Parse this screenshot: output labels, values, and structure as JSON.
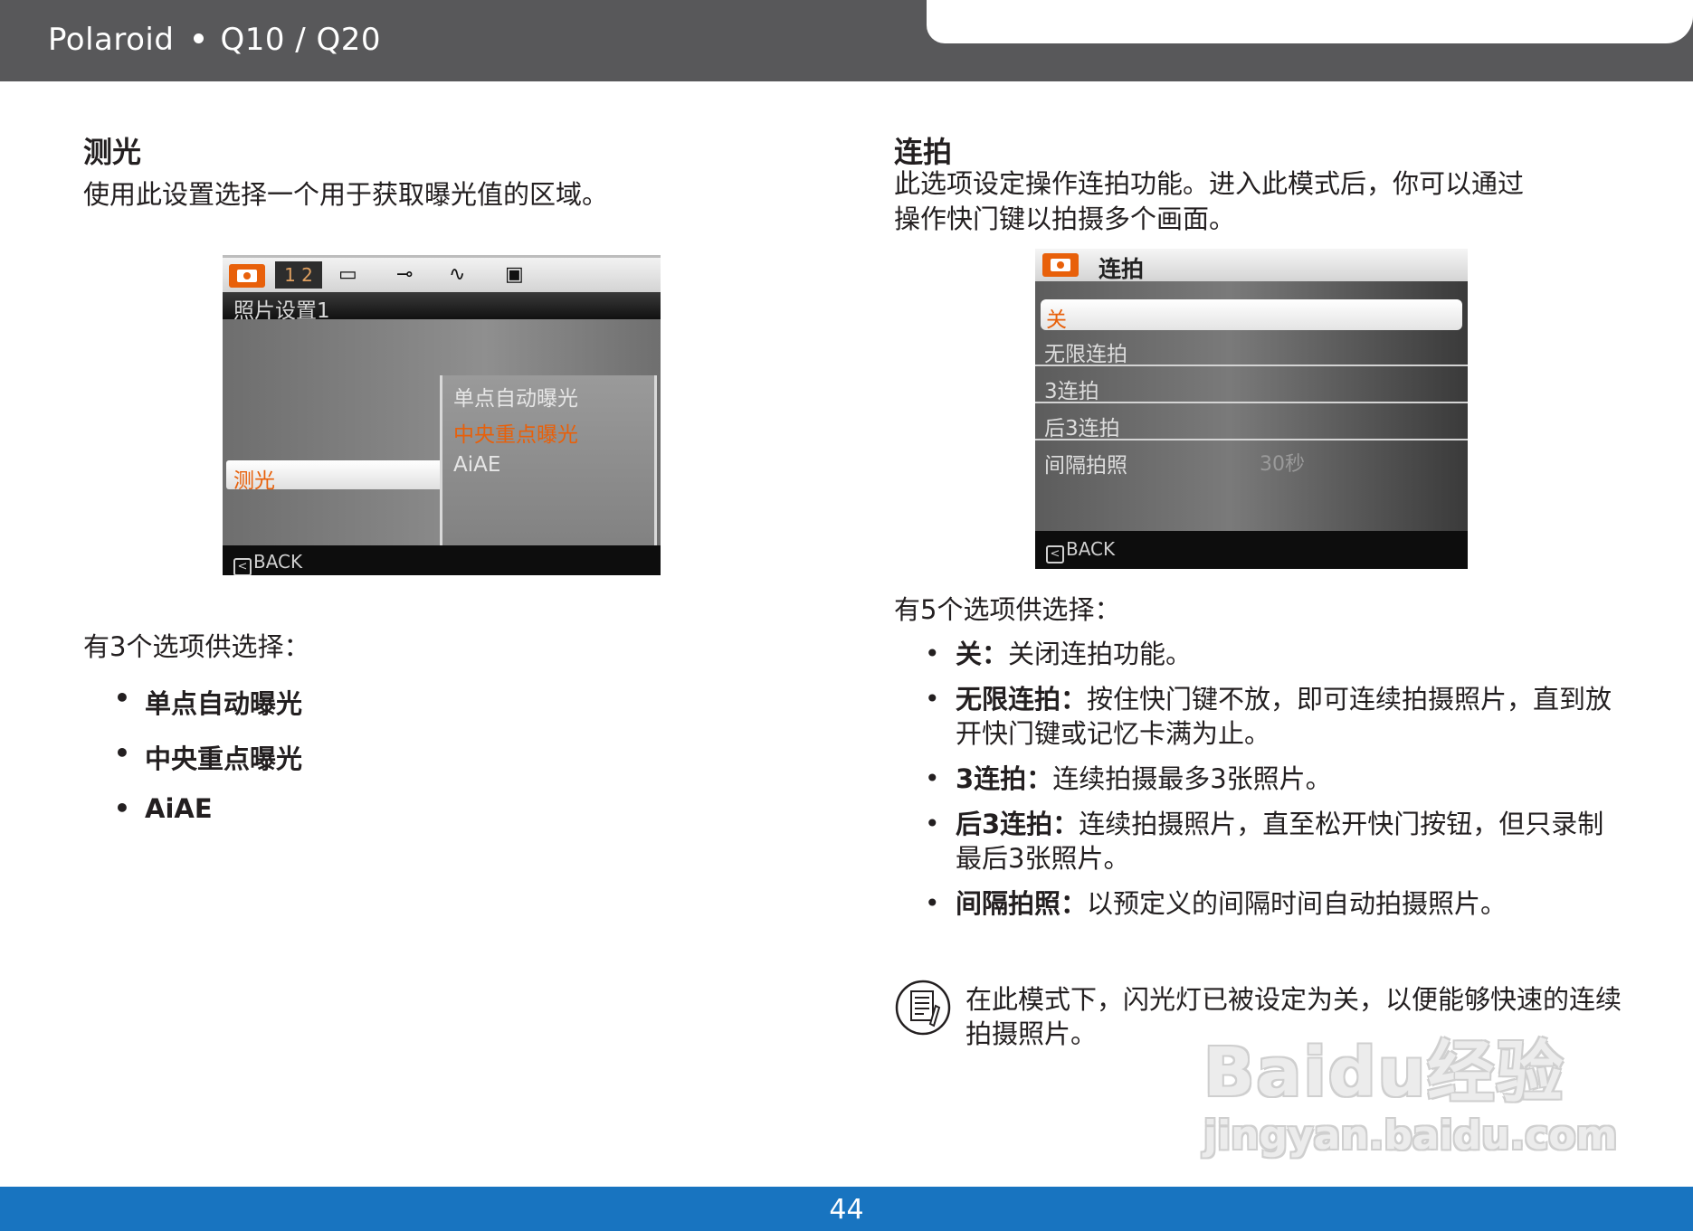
{
  "header": {
    "brand": "Polaroid",
    "model": "Q10 / Q20"
  },
  "left": {
    "title": "测光",
    "desc": "使用此设置选择一个用于获取曝光值的区域。",
    "screen": {
      "tab_numbers": "1 2",
      "title": "照片设置1",
      "selected_label": "测光",
      "options": [
        "单点自动曝光",
        "中央重点曝光",
        "AiAE"
      ],
      "active_option": "中央重点曝光",
      "back": "BACK"
    },
    "count_text": "有3个选项供选择：",
    "bullets": [
      "单点自动曝光",
      "中央重点曝光",
      "AiAE"
    ]
  },
  "right": {
    "title": "连拍",
    "desc_line1": "此选项设定操作连拍功能。进入此模式后，你可以通过",
    "desc_line2": "操作快门键以拍摄多个画面。",
    "screen": {
      "title": "连拍",
      "rows": [
        {
          "label": "关",
          "value": ""
        },
        {
          "label": "无限连拍",
          "value": ""
        },
        {
          "label": "3连拍",
          "value": ""
        },
        {
          "label": "后3连拍",
          "value": ""
        },
        {
          "label": "间隔拍照",
          "value": "30秒"
        }
      ],
      "back": "BACK"
    },
    "count_text": "有5个选项供选择：",
    "bullets": [
      {
        "term": "关：",
        "text": "关闭连拍功能。"
      },
      {
        "term": "无限连拍：",
        "text": "按住快门键不放，即可连续拍摄照片，直到放开快门键或记忆卡满为止。"
      },
      {
        "term": "3连拍：",
        "text": "连续拍摄最多3张照片。"
      },
      {
        "term": "后3连拍：",
        "text": "连续拍摄照片，直至松开快门按钮，但只录制最后3张照片。"
      },
      {
        "term": "间隔拍照：",
        "text": "以预定义的间隔时间自动拍摄照片。"
      }
    ],
    "note": "在此模式下，闪光灯已被设定为关，以便能够快速的连续拍摄照片。"
  },
  "watermark": {
    "main": "Baidu经验",
    "url": "jingyan.baidu.com"
  },
  "footer": {
    "page_number": "44"
  },
  "colors": {
    "header_bg": "#58585a",
    "footer_bg": "#1874c0",
    "accent_orange": "#e8600a"
  }
}
